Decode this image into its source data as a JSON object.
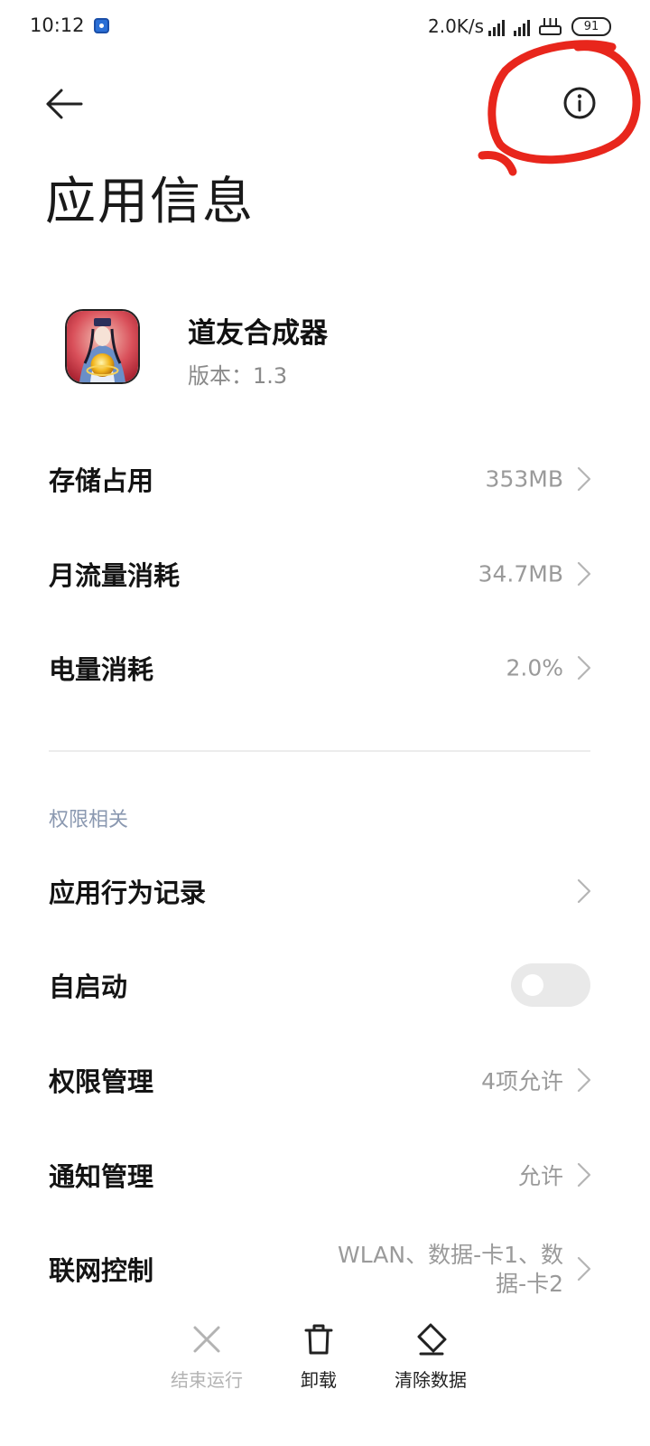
{
  "status_bar": {
    "time": "10:12",
    "net_speed": "2.0K/s",
    "battery": "91",
    "icons": [
      "app-notification-icon",
      "signal-icon",
      "signal-icon",
      "wifi-router-icon",
      "battery-icon"
    ]
  },
  "header": {
    "back_icon": "back-arrow-icon",
    "info_icon": "info-icon",
    "annotation_color": "#e8261c"
  },
  "page": {
    "title": "应用信息"
  },
  "app": {
    "name": "道友合成器",
    "version": "版本：1.3"
  },
  "usage": [
    {
      "label": "存储占用",
      "value": "353MB"
    },
    {
      "label": "月流量消耗",
      "value": "34.7MB"
    },
    {
      "label": "电量消耗",
      "value": "2.0%"
    }
  ],
  "permissions": {
    "section_title": "权限相关",
    "behavior_log": {
      "label": "应用行为记录"
    },
    "autostart": {
      "label": "自启动",
      "enabled": false
    },
    "permission_manage": {
      "label": "权限管理",
      "value": "4项允许"
    },
    "notification_manage": {
      "label": "通知管理",
      "value": "允许"
    },
    "network_control": {
      "label": "联网控制",
      "value": "WLAN、数据-卡1、数据-卡2"
    }
  },
  "bottom_bar": {
    "force_stop": "结束运行",
    "uninstall": "卸载",
    "clear_data": "清除数据"
  }
}
